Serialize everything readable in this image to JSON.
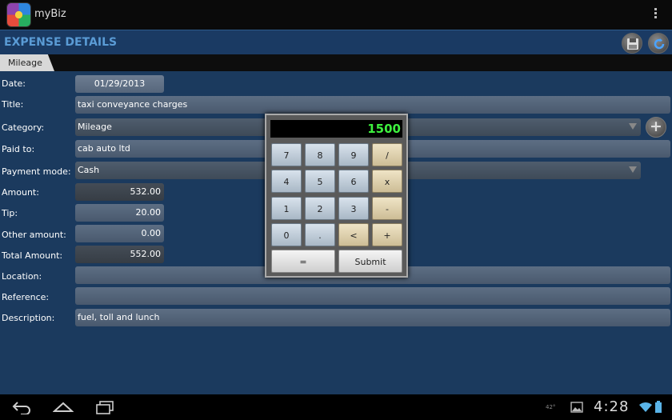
{
  "app": {
    "title": "myBiz"
  },
  "header": {
    "title": "EXPENSE DETAILS"
  },
  "tabs": [
    {
      "label": "Mileage"
    }
  ],
  "form": {
    "date": {
      "label": "Date:",
      "value": "01/29/2013"
    },
    "title": {
      "label": "Title:",
      "value": "taxi conveyance charges"
    },
    "category": {
      "label": "Category:",
      "value": "Mileage"
    },
    "paid_to": {
      "label": "Paid to:",
      "value": "cab auto ltd"
    },
    "payment_mode": {
      "label": "Payment mode:",
      "value": "Cash"
    },
    "amount": {
      "label": "Amount:",
      "value": "532.00"
    },
    "tip": {
      "label": "Tip:",
      "value": "20.00"
    },
    "other_amount": {
      "label": "Other amount:",
      "value": "0.00"
    },
    "total_amount": {
      "label": "Total Amount:",
      "value": "552.00"
    },
    "location": {
      "label": "Location:",
      "value": ""
    },
    "reference": {
      "label": "Reference:",
      "value": ""
    },
    "description": {
      "label": "Description:",
      "value": "fuel, toll and lunch"
    }
  },
  "calculator": {
    "display": "1500",
    "keys": [
      "7",
      "8",
      "9",
      "/",
      "4",
      "5",
      "6",
      "x",
      "1",
      "2",
      "3",
      "-",
      "0",
      ".",
      "<",
      "+"
    ],
    "equals_label": "=",
    "submit_label": "Submit"
  },
  "status": {
    "time": "4:28",
    "small": "42°"
  },
  "icons": {
    "save": "floppy-disk-icon",
    "refresh": "refresh-icon",
    "add": "plus-icon",
    "back": "back-icon",
    "home": "home-icon",
    "recents": "recent-apps-icon"
  },
  "colors": {
    "background": "#1b3a5e",
    "header_text": "#5a9bd5",
    "display_text": "#3ef03e"
  }
}
